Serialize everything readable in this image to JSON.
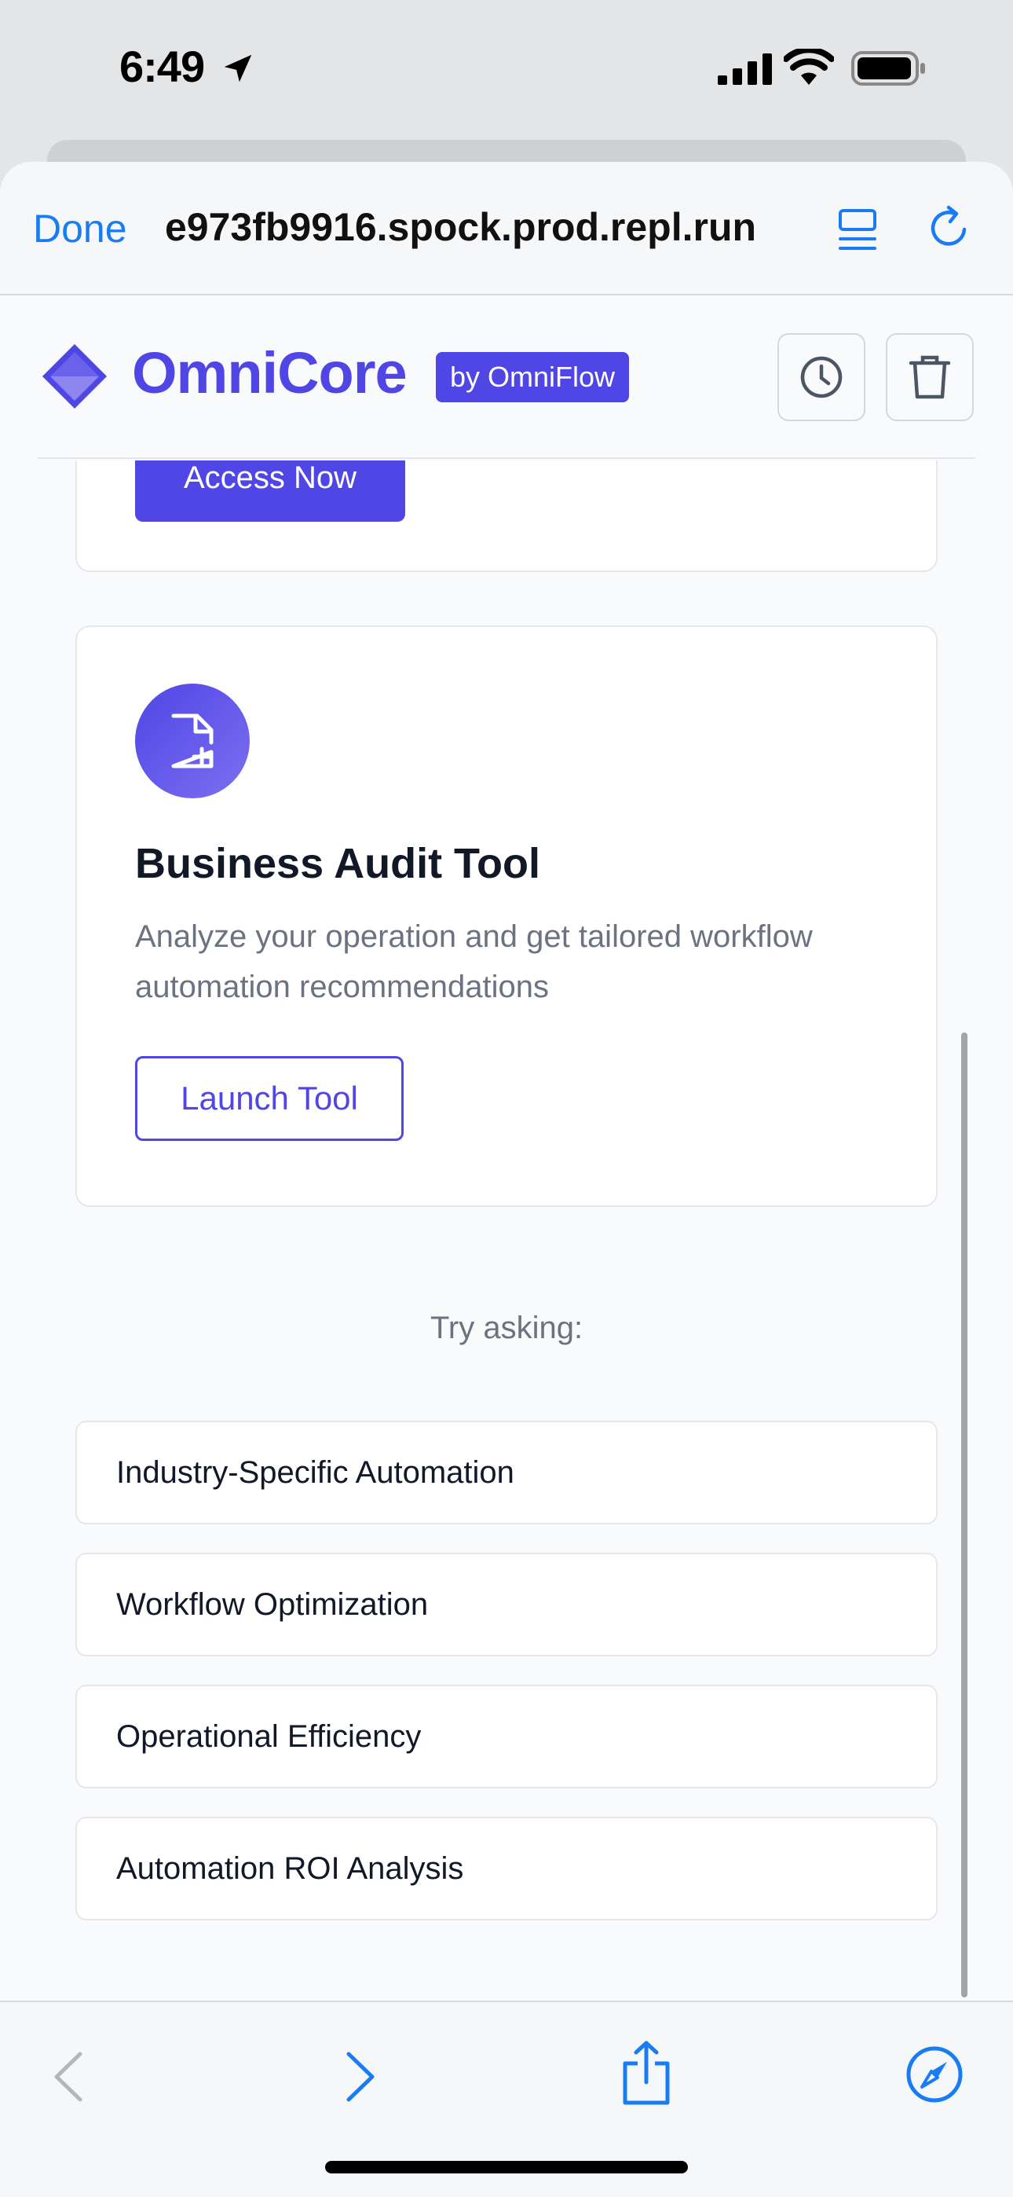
{
  "status_bar": {
    "time": "6:49"
  },
  "browser": {
    "done_label": "Done",
    "url": "e973fb9916.spock.prod.repl.run"
  },
  "app": {
    "brand_name": "OmniCore",
    "brand_badge": "by OmniFlow",
    "accent_color": "#4f46e5"
  },
  "cards": {
    "access_button": "Access Now",
    "audit": {
      "title": "Business Audit Tool",
      "description": "Analyze your operation and get tailored workflow automation recommendations",
      "button": "Launch Tool"
    }
  },
  "suggestions": {
    "label": "Try asking:",
    "items": [
      "Industry-Specific Automation",
      "Workflow Optimization",
      "Operational Efficiency",
      "Automation ROI Analysis"
    ]
  },
  "icons": {
    "history": "clock-icon",
    "trash": "trash-icon",
    "audit": "file-plus-icon",
    "back": "chevron-left-icon",
    "forward": "chevron-right-icon",
    "share": "share-icon",
    "compass": "compass-icon"
  }
}
